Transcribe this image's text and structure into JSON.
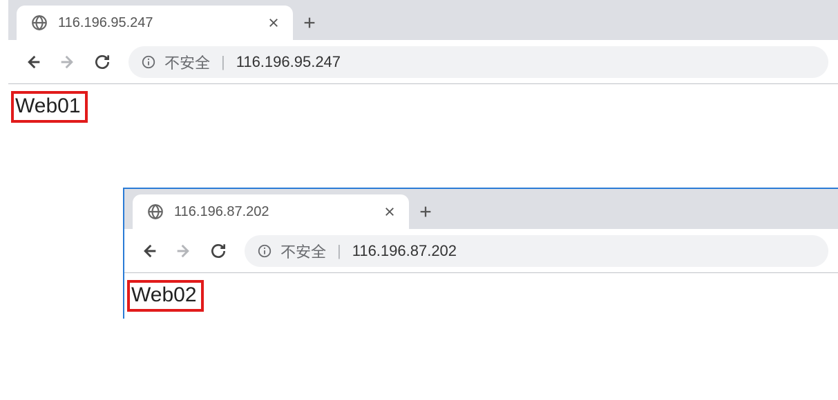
{
  "window1": {
    "tab_title": "116.196.95.247",
    "security_label": "不安全",
    "address": "116.196.95.247",
    "page_text": "Web01"
  },
  "window2": {
    "tab_title": "116.196.87.202",
    "security_label": "不安全",
    "address": "116.196.87.202",
    "page_text": "Web02"
  }
}
